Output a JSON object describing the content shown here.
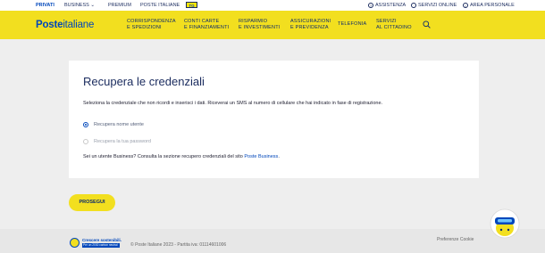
{
  "topbar": {
    "privati": "PRIVATI",
    "business": "BUSINESS",
    "premium": "PREMIUM",
    "poste_italiane": "POSTE ITALIANE",
    "tg_brand": "TG",
    "tg_sub": "Poste",
    "assistenza": "ASSISTENZA",
    "servizi_online": "SERVIZI ONLINE",
    "area_personale": "AREA PERSONALE"
  },
  "brand": {
    "name_bold": "Poste",
    "name_thin": "italiane",
    "primary_color": "#0047bb",
    "accent_color": "#f2df1f"
  },
  "nav": {
    "items": [
      {
        "line1": "CORRISPONDENZA",
        "line2": "E SPEDIZIONI"
      },
      {
        "line1": "CONTI CARTE",
        "line2": "E FINANZIAMENTI"
      },
      {
        "line1": "RISPARMIO",
        "line2": "E INVESTIMENTI"
      },
      {
        "line1": "ASSICURAZIONI",
        "line2": "E PREVIDENZA"
      },
      {
        "line1": "TELEFONIA",
        "line2": ""
      },
      {
        "line1": "SERVIZI",
        "line2": "AL CITTADINO"
      }
    ],
    "search_icon": "search-icon"
  },
  "card": {
    "title": "Recupera le credenziali",
    "intro": "Seleziona la credenziale che non ricordi e inserisci i dati. Riceverai un SMS al numero di cellulare che hai indicato in fase di registrazione.",
    "options": [
      {
        "label": "Recupera nome utente",
        "selected": true
      },
      {
        "label": "Recupera la tua password",
        "selected": false
      }
    ],
    "business_text": "Sei un utente Business? Consulta la sezione recupero credenziali del sito ",
    "business_link": "Poste Business",
    "business_end": "."
  },
  "actions": {
    "proceed": "PROSEGUI"
  },
  "footer": {
    "logo_line1": "Crescere sostenibili.",
    "logo_line2": "Per un 2030 carbon neutral",
    "copyright": "© Poste Italiane 2023 - Partita iva: 01114601006",
    "cookie": "Preferenze Cookie"
  }
}
